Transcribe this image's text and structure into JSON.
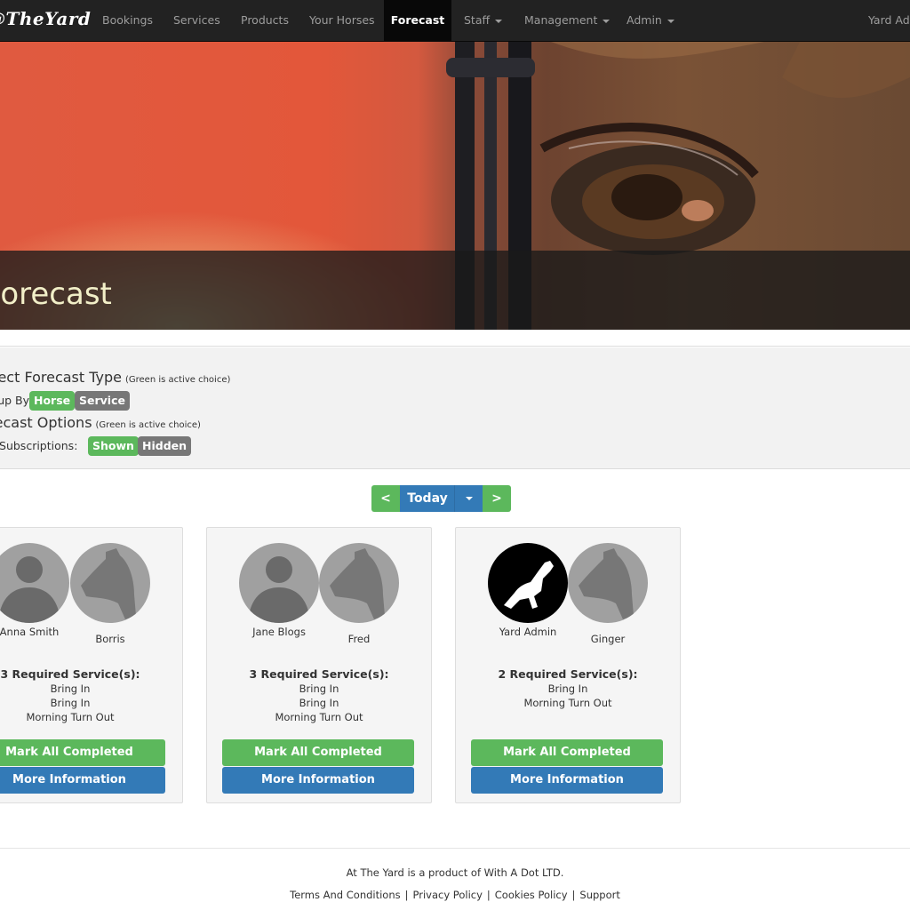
{
  "nav": {
    "brand": "@TheYard",
    "items": [
      "Bookings",
      "Services",
      "Products",
      "Your Horses",
      "Forecast",
      "Staff",
      "Management",
      "Admin"
    ],
    "active": "Forecast",
    "user": "Yard Admin"
  },
  "hero": {
    "title": "Forecast"
  },
  "options": {
    "forecast_type_heading": "Select Forecast Type",
    "forecast_type_hint": "(Green is active choice)",
    "group_by_label": "Group By:",
    "group_by_horse": "Horse",
    "group_by_service": "Service",
    "forecast_options_heading": "Forecast Options",
    "forecast_options_hint": "(Green is active choice)",
    "subscriptions_label": "Paid Subscriptions:",
    "subscriptions_shown": "Shown",
    "subscriptions_hidden": "Hidden"
  },
  "date_nav": {
    "prev": "<",
    "today": "Today",
    "next": ">"
  },
  "cards": [
    {
      "person": "Anna Smith",
      "horse": "Borris",
      "required": "3 Required Service(s):",
      "services": [
        "Bring In",
        "Bring In",
        "Morning Turn Out"
      ],
      "mark_label": "Mark All Completed",
      "info_label": "More Information"
    },
    {
      "person": "Jane Blogs",
      "horse": "Fred",
      "required": "3 Required Service(s):",
      "services": [
        "Bring In",
        "Bring In",
        "Morning Turn Out"
      ],
      "mark_label": "Mark All Completed",
      "info_label": "More Information"
    },
    {
      "person": "Yard Admin",
      "horse": "Ginger",
      "required": "2 Required Service(s):",
      "services": [
        "Bring In",
        "Morning Turn Out"
      ],
      "mark_label": "Mark All Completed",
      "info_label": "More Information"
    }
  ],
  "footer": {
    "text": "At The Yard is a product of With A Dot LTD.",
    "links": [
      "Terms And Conditions",
      "Privacy Policy",
      "Cookies Policy",
      "Support"
    ]
  },
  "colors": {
    "navbar": "#222222",
    "green": "#5cb85c",
    "blue": "#337ab7",
    "grey_pill": "#777777"
  }
}
